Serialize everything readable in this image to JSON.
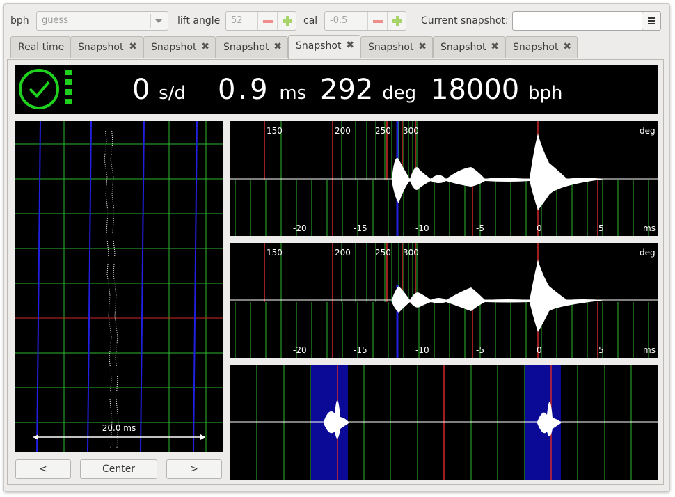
{
  "toolbar": {
    "bph_label": "bph",
    "bph_value": "guess",
    "lift_label": "lift angle",
    "lift_value": "52",
    "cal_label": "cal",
    "cal_value": "-0.5",
    "snapshot_label": "Current snapshot:",
    "snapshot_value": ""
  },
  "tabs": [
    {
      "label": "Real time"
    },
    {
      "label": "Snapshot",
      "close": "✖"
    },
    {
      "label": "Snapshot",
      "close": "✖"
    },
    {
      "label": "Snapshot",
      "close": "✖"
    },
    {
      "label": "Snapshot",
      "close": "✖"
    },
    {
      "label": "Snapshot",
      "close": "✖"
    },
    {
      "label": "Snapshot",
      "close": "✖"
    },
    {
      "label": "Snapshot",
      "close": "✖"
    }
  ],
  "active_tab": 4,
  "readout": {
    "rate": "0",
    "rate_unit": "s/d",
    "beat_error": "0.9",
    "beat_error_unit": "ms",
    "amplitude": "292",
    "amplitude_unit": "deg",
    "bph": "18000",
    "bph_unit": "bph"
  },
  "status_icon": "clock-check-icon",
  "colors": {
    "signal_green": "#1dd11d",
    "grid_green": "#2db82d",
    "marker_red": "#d02828",
    "marker_blue": "#2020e0",
    "highlight_blue": "#0a0a96"
  },
  "paperstrip": {
    "scale_label": "20.0 ms"
  },
  "waveform_top": {
    "deg_ticks": [
      "150",
      "200",
      "250",
      "300"
    ],
    "deg_unit": "deg",
    "ms_ticks": [
      "-20",
      "-15",
      "-10",
      "-5",
      "0",
      "5"
    ],
    "ms_unit": "ms"
  },
  "waveform_mid": {
    "deg_ticks": [
      "150",
      "200",
      "250",
      "300"
    ],
    "deg_unit": "deg",
    "ms_ticks": [
      "-20",
      "-15",
      "-10",
      "-5",
      "0",
      "5"
    ],
    "ms_unit": "ms"
  },
  "buttons": {
    "prev": "<",
    "center": "Center",
    "next": ">"
  }
}
